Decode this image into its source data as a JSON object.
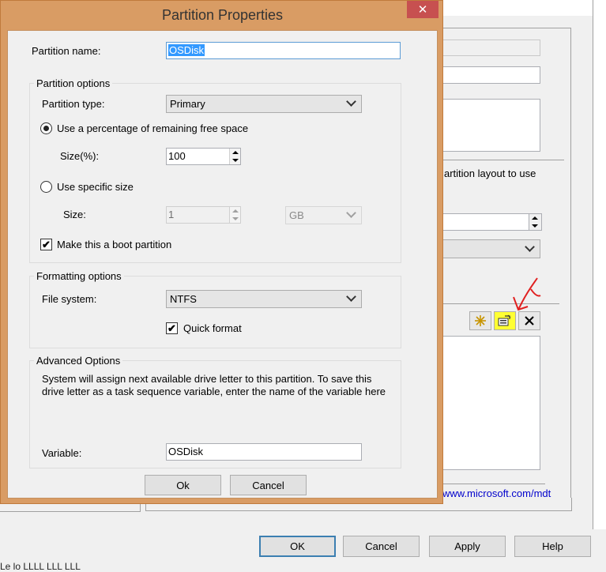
{
  "dialog": {
    "title": "Partition Properties",
    "close_glyph": "✕",
    "partition_name_label": "Partition name:",
    "partition_name_value": "OSDisk",
    "partition_options_title": "Partition options",
    "partition_type_label": "Partition type:",
    "partition_type_value": "Primary",
    "use_percentage_label": "Use a percentage of remaining free space",
    "use_percentage_checked": true,
    "size_percent_label": "Size(%):",
    "size_percent_value": "100",
    "use_specific_label": "Use specific size",
    "use_specific_checked": false,
    "size_label": "Size:",
    "size_value": "1",
    "size_unit": "GB",
    "boot_partition_label": "Make this a boot partition",
    "boot_partition_checked": true,
    "formatting_options_title": "Formatting options",
    "file_system_label": "File system:",
    "file_system_value": "NTFS",
    "quick_format_label": "Quick format",
    "quick_format_checked": true,
    "advanced_options_title": "Advanced Options",
    "advanced_description": "System will assign next available drive letter to this partition. To save this drive letter as a task sequence variable, enter the name of the variable here",
    "variable_label": "Variable:",
    "variable_value": "OSDisk",
    "ok_label": "Ok",
    "cancel_label": "Cancel",
    "check_glyph": "✔"
  },
  "background": {
    "partial_text": "artition layout to use",
    "link_text": "www.microsoft.com/mdt",
    "toolbar_icons": [
      "new-icon",
      "properties-icon",
      "delete-icon"
    ],
    "highlight_color": "#ffff33",
    "annotation_color": "#e02020",
    "ok_label": "OK",
    "cancel_label": "Cancel",
    "apply_label": "Apply",
    "help_label": "Help",
    "bottom_partial_text": "Le lo LLLL LLL LLL"
  }
}
